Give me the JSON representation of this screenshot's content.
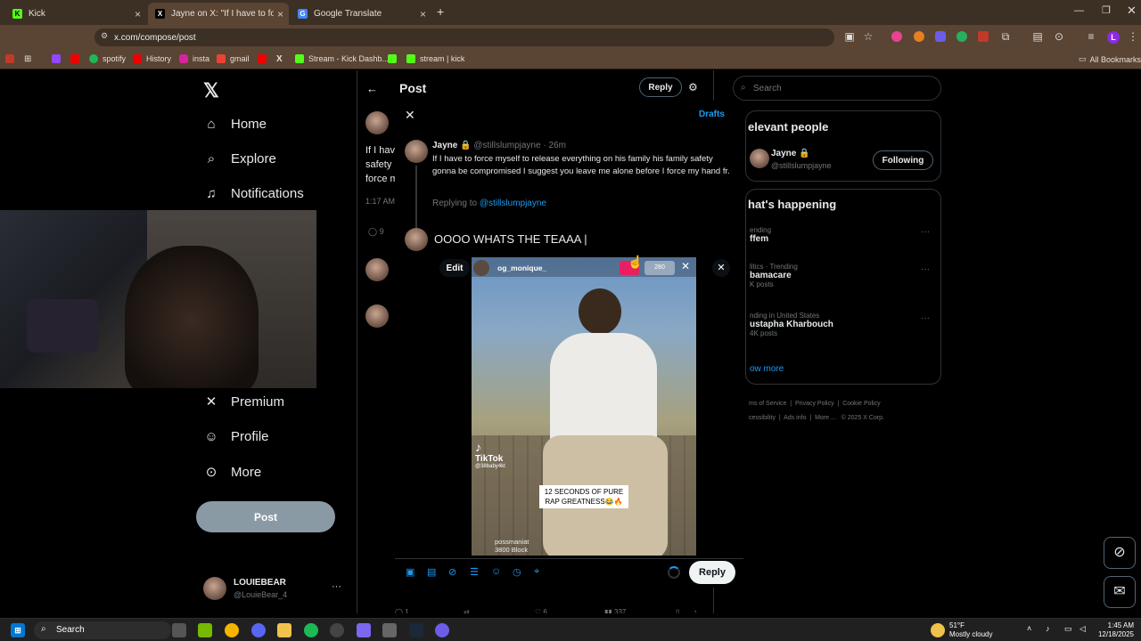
{
  "browser": {
    "tabs": [
      {
        "title": "Kick",
        "icon": "kick-icon"
      },
      {
        "title": "Jayne on X: \"If I have to forc",
        "icon": "x-icon"
      },
      {
        "title": "Google Translate",
        "icon": "translate-icon"
      }
    ],
    "url": "x.com/compose/post",
    "bookmarks": [
      "spotify",
      "History",
      "insta",
      "gmail",
      "Stream - Kick Dashb...",
      "stream | kick"
    ],
    "all_bookmarks_label": "All Bookmarks"
  },
  "sidebar": {
    "items": [
      {
        "label": "Home",
        "icon": "home-icon"
      },
      {
        "label": "Explore",
        "icon": "search-icon"
      },
      {
        "label": "Notifications",
        "icon": "bell-icon"
      },
      {
        "label": "Premium",
        "icon": "x-icon"
      },
      {
        "label": "Profile",
        "icon": "person-icon"
      },
      {
        "label": "More",
        "icon": "more-circle-icon"
      }
    ],
    "post_button": "Post",
    "account": {
      "name": "LOUIEBEAR",
      "handle": "@LouieBear_4"
    }
  },
  "main": {
    "header_title": "Post",
    "reply_button": "Reply",
    "fragments": [
      "If I hav",
      "safety",
      "force m",
      "1:17 AM",
      "9"
    ]
  },
  "modal": {
    "drafts_label": "Drafts",
    "original": {
      "name": "Jayne",
      "handle": "@stillslumpjayne",
      "time": "· 26m",
      "text": "If I have to force myself to release everything on his family his family safety gonna be compromised I suggest you leave me alone before I force my hand fr."
    },
    "replying_to_prefix": "Replying to",
    "replying_to_handle": "@stillslumpjayne",
    "compose_text": "OOOO WHATS THE TEAAA |",
    "media": {
      "edit_label": "Edit",
      "user": "og_monique_",
      "badge": "280",
      "tiktok_label": "TikTok",
      "tiktok_handle": "@38baby4kt",
      "caption_line1": "12 SECONDS OF PURE",
      "caption_line2": "RAP GREATNESS😂🔥",
      "bottom_user": "possmaniat",
      "bottom_sub": "3800 Block"
    },
    "reply_button": "Reply"
  },
  "right": {
    "search_placeholder": "Search",
    "relevant_title": "elevant people",
    "person": {
      "name": "Jayne",
      "handle": "@stillslumpjayne",
      "button": "Following"
    },
    "happening_title": "hat's happening",
    "trends": [
      {
        "context": "ending",
        "name": "ffem",
        "count": ""
      },
      {
        "context": "litics · Trending",
        "name": "bamacare",
        "count": "K posts"
      },
      {
        "context": "nding in United States",
        "name": "ustapha Kharbouch",
        "count": "4K posts"
      }
    ],
    "show_more": "ow more",
    "footer": [
      "ms of Service",
      "Privacy Policy",
      "Cookie Policy",
      "cessibility",
      "Ads info",
      "More ...",
      "© 2025 X Corp."
    ]
  },
  "bottom_actions": [
    "1",
    "6",
    "337"
  ],
  "taskbar": {
    "search_label": "Search",
    "weather_temp": "51°F",
    "weather_text": "Mostly cloudy",
    "time": "1:45 AM",
    "date": "12/18/2025"
  },
  "colors": {
    "accent": "#1d9bf0",
    "brand_purple": "#8a2be2"
  }
}
